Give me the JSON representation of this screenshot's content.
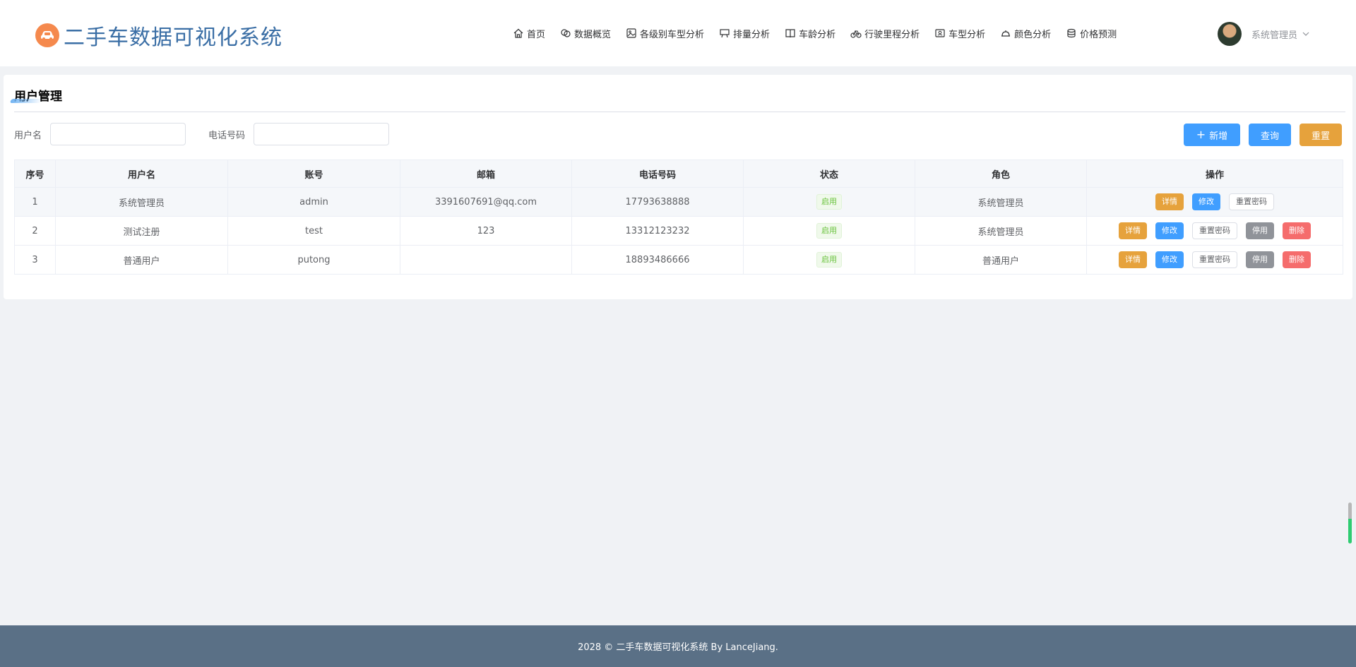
{
  "header": {
    "title": "二手车数据可视化系统",
    "logo_icon": "car-icon",
    "nav": [
      {
        "label": "首页",
        "icon": "home-icon"
      },
      {
        "label": "数据概览",
        "icon": "chat-icon"
      },
      {
        "label": "各级别车型分析",
        "icon": "picture-icon"
      },
      {
        "label": "排量分析",
        "icon": "board-icon"
      },
      {
        "label": "车龄分析",
        "icon": "book-icon"
      },
      {
        "label": "行驶里程分析",
        "icon": "bicycle-icon"
      },
      {
        "label": "车型分析",
        "icon": "postcard-icon"
      },
      {
        "label": "颜色分析",
        "icon": "dish-icon"
      },
      {
        "label": "价格预测",
        "icon": "coin-icon"
      }
    ],
    "user_name": "系统管理员"
  },
  "card": {
    "title": "用户管理",
    "filters": {
      "username_label": "用户名",
      "username_value": "",
      "phone_label": "电话号码",
      "phone_value": ""
    },
    "buttons": {
      "add": "新增",
      "query": "查询",
      "reset": "重置"
    }
  },
  "table": {
    "columns": [
      "序号",
      "用户名",
      "账号",
      "邮箱",
      "电话号码",
      "状态",
      "角色",
      "操作"
    ],
    "rows": [
      {
        "index": "1",
        "username": "系统管理员",
        "account": "admin",
        "email": "3391607691@qq.com",
        "phone": "17793638888",
        "status": "启用",
        "role": "系统管理员",
        "actions": {
          "detail": "详情",
          "edit": "修改",
          "reset_password": "重置密码"
        }
      },
      {
        "index": "2",
        "username": "测试注册",
        "account": "test",
        "email": "123",
        "phone": "13312123232",
        "status": "启用",
        "role": "系统管理员",
        "actions": {
          "detail": "详情",
          "edit": "修改",
          "reset_password": "重置密码",
          "disable": "停用",
          "delete": "删除"
        }
      },
      {
        "index": "3",
        "username": "普通用户",
        "account": "putong",
        "email": "",
        "phone": "18893486666",
        "status": "启用",
        "role": "普通用户",
        "actions": {
          "detail": "详情",
          "edit": "修改",
          "reset_password": "重置密码",
          "disable": "停用",
          "delete": "删除"
        }
      }
    ]
  },
  "footer": {
    "text": "2028 © 二手车数据可视化系统 By LanceJiang."
  },
  "colors": {
    "primary": "#409eff",
    "warning": "#e6a23c",
    "success": "#67c23a",
    "info": "#909399",
    "danger": "#f56c6c",
    "footer_bg": "#5a7086",
    "brand_title": "#3a6ea5"
  }
}
